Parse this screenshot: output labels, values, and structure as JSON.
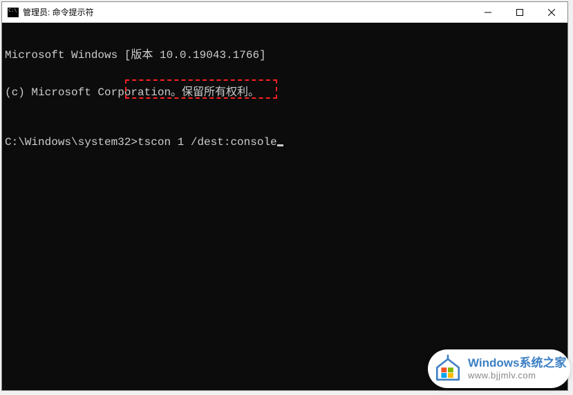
{
  "window": {
    "title": "管理员: 命令提示符"
  },
  "terminal": {
    "line1": "Microsoft Windows [版本 10.0.19043.1766]",
    "line2": "(c) Microsoft Corporation。保留所有权利。",
    "prompt": "C:\\Windows\\system32>",
    "command": "tscon 1 /dest:console"
  },
  "watermark": {
    "brand": "Windows系统之家",
    "url": "www.bjjmlv.com"
  }
}
